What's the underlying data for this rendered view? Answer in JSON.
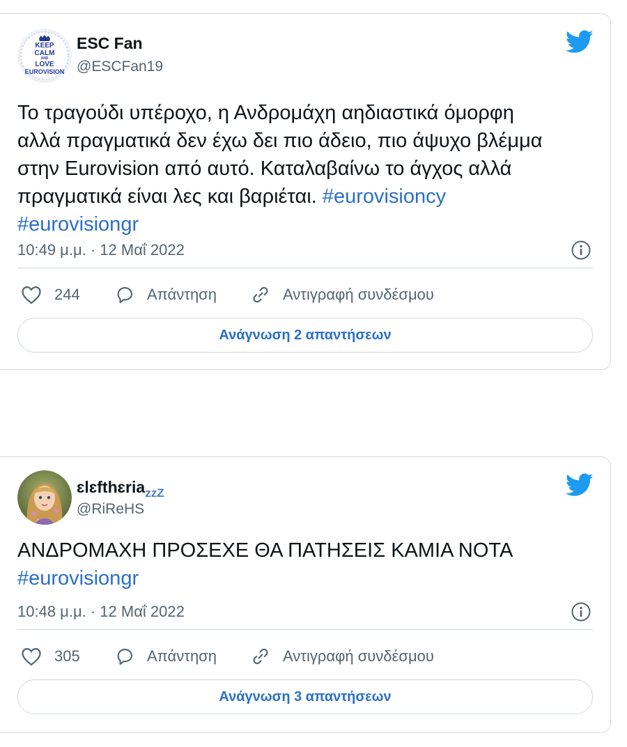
{
  "colors": {
    "link": "#2b6fc9",
    "twitter_blue": "#1d9bf0",
    "muted": "#536471",
    "border": "#cfd9de"
  },
  "tweets": [
    {
      "display_name": "ESC Fan",
      "handle": "@ESCFan19",
      "avatar_text": [
        "KEEP",
        "CALM",
        "AND",
        "LOVE",
        "EUROVISION"
      ],
      "text_lines": [
        "Το τραγούδι υπέροχο, η Ανδρομάχη αηδιαστικά όμορφη",
        "αλλά πραγματικά δεν έχω δει πιο άδειο, πιο άψυχο βλέμμα",
        "στην Eurovision από αυτό. Καταλαβαίνω το άγχος αλλά",
        "πραγματικά είναι λες και βαριέται."
      ],
      "hashtags": [
        "#eurovisioncy",
        "#eurovisiongr"
      ],
      "timestamp": "10:49 μ.μ. · 12 Μαΐ 2022",
      "likes": "244",
      "reply_label": "Απάντηση",
      "copy_link_label": "Αντιγραφή συνδέσμου",
      "read_replies_label": "Ανάγνωση 2 απαντήσεων"
    },
    {
      "display_name": "ɛlɛfthɛria",
      "display_name_suffix": "zzZ",
      "handle": "@RiReHS",
      "text_lines": [
        "ΑΝΔΡΟΜΑΧΗ ΠΡΟΣΕΧΕ ΘΑ ΠΑΤΗΣΕΙΣ ΚΑΜΙΑ ΝΟΤΑ"
      ],
      "hashtags": [
        "#eurovisiongr"
      ],
      "timestamp": "10:48 μ.μ. · 12 Μαΐ 2022",
      "likes": "305",
      "reply_label": "Απάντηση",
      "copy_link_label": "Αντιγραφή συνδέσμου",
      "read_replies_label": "Ανάγνωση 3 απαντήσεων"
    }
  ]
}
